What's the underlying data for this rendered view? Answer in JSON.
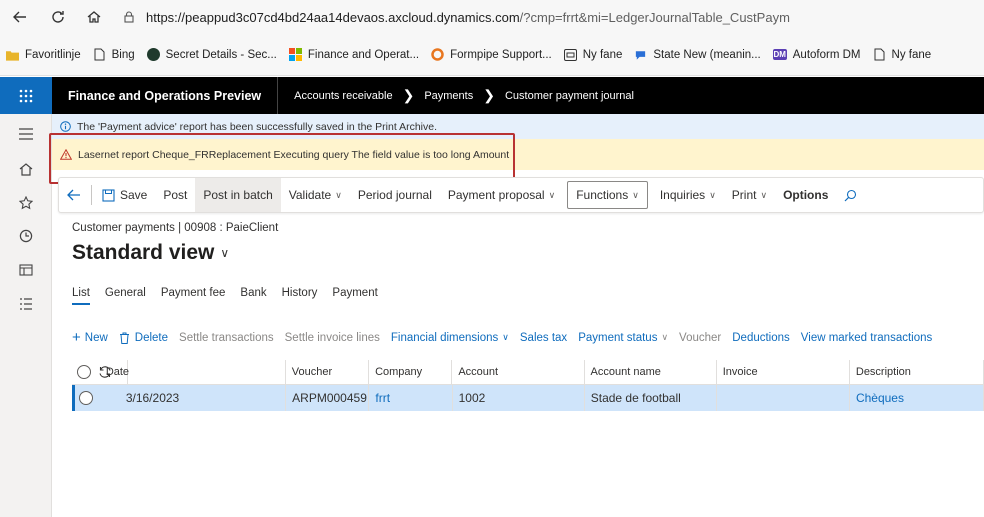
{
  "browser": {
    "url_host": "https://peappud3c07cd4bd24aa14devaos.axcloud.dynamics.com",
    "url_path": "/?cmp=frrt&mi=LedgerJournalTable_CustPaym",
    "favorites": [
      {
        "label": "Favoritlinje",
        "icon": "folder-icon",
        "color": "#e8b42a"
      },
      {
        "label": "Bing",
        "icon": "page-icon",
        "color": ""
      },
      {
        "label": "Secret Details - Sec...",
        "icon": "secret-icon",
        "color": "#1f3a2c"
      },
      {
        "label": "Finance and Operat...",
        "icon": "windows-icon",
        "color": ""
      },
      {
        "label": "Formpipe Support...",
        "icon": "formpipe-icon",
        "color": "#e8761f"
      },
      {
        "label": "Ny fane",
        "icon": "tab-icon",
        "color": ""
      },
      {
        "label": "State New (meanin...",
        "icon": "state-icon",
        "color": "#2a6fd6"
      },
      {
        "label": "Autoform DM",
        "icon": "dm-icon",
        "color": "#5b3fb4"
      },
      {
        "label": "Ny fane",
        "icon": "page-icon",
        "color": ""
      }
    ],
    "dm_badge": "DM"
  },
  "header": {
    "app_title": "Finance and Operations Preview",
    "breadcrumb": [
      "Accounts receivable",
      "Payments",
      "Customer payment journal"
    ]
  },
  "messages": {
    "info": "The 'Payment advice' report has been successfully saved in the Print Archive.",
    "warning": "Lasernet report Cheque_FRReplacement   Executing query The field value is too long Amount"
  },
  "actionpane": {
    "save": "Save",
    "post": "Post",
    "post_in_batch": "Post in batch",
    "validate": "Validate",
    "period_journal": "Period journal",
    "payment_proposal": "Payment proposal",
    "functions": "Functions",
    "inquiries": "Inquiries",
    "print": "Print",
    "options": "Options"
  },
  "page": {
    "crumb": "Customer payments   |   00908 : PaieClient",
    "title": "Standard view"
  },
  "tabs": [
    "List",
    "General",
    "Payment fee",
    "Bank",
    "History",
    "Payment"
  ],
  "grid_toolbar": {
    "new": "New",
    "delete": "Delete",
    "settle_transactions": "Settle transactions",
    "settle_invoice_lines": "Settle invoice lines",
    "financial_dimensions": "Financial dimensions",
    "sales_tax": "Sales tax",
    "payment_status": "Payment status",
    "voucher": "Voucher",
    "deductions": "Deductions",
    "view_marked": "View marked transactions"
  },
  "grid": {
    "columns": [
      "Date",
      "Voucher",
      "Company",
      "Account",
      "Account name",
      "Invoice",
      "Description"
    ],
    "rows": [
      {
        "date": "3/16/2023",
        "voucher": "ARPM000459",
        "company": "frrt",
        "account": "1002",
        "account_name": "Stade de football",
        "invoice": "",
        "description": "Chèques"
      }
    ]
  },
  "colors": {
    "accent": "#0f6cbd",
    "header_bg": "#000000",
    "info_bg": "#e6f0fb",
    "warning_bg": "#fff4ce",
    "highlight_border": "#b83232",
    "selected_row": "#cfe4fa"
  }
}
